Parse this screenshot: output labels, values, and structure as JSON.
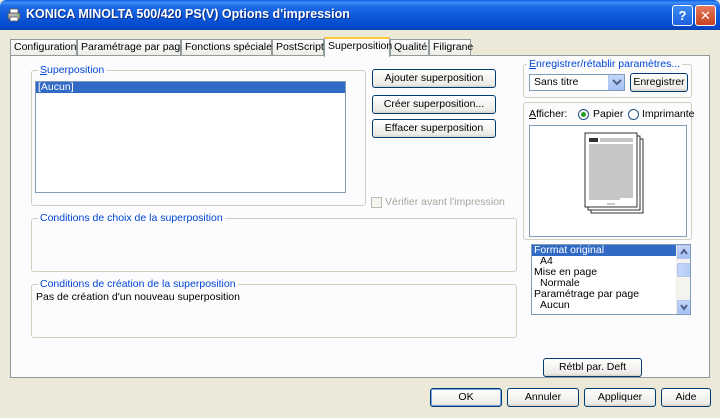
{
  "window": {
    "title": "KONICA MINOLTA 500/420 PS(V) Options d'impression",
    "help_label": "?",
    "close_label": "✕"
  },
  "tabs": [
    {
      "label": "Configuration"
    },
    {
      "label": "Paramétrage par page"
    },
    {
      "label": "Fonctions spéciales"
    },
    {
      "label": "PostScript"
    },
    {
      "label": "Superposition",
      "active": true
    },
    {
      "label": "Qualité"
    },
    {
      "label": "Filigrane"
    }
  ],
  "overlay": {
    "group_title": "Superposition",
    "list_items": [
      "[Aucun]"
    ],
    "add_button": "Ajouter superposition",
    "create_button": "Créer superposition...",
    "delete_button": "Effacer superposition",
    "verify_label": "Vérifier avant l'impression",
    "verify_checked": false
  },
  "choice_conditions": {
    "title": "Conditions de choix de la superposition",
    "text": ""
  },
  "creation_conditions": {
    "title": "Conditions de création de la superposition",
    "text": "Pas de création d'un nouveau superposition"
  },
  "save_restore": {
    "title": "Enregistrer/rétablir paramètres...",
    "combo_value": "Sans titre",
    "save_button": "Enregistrer"
  },
  "display": {
    "label": "Afficher:",
    "option_paper": "Papier",
    "option_printer": "Imprimante",
    "selected": "paper"
  },
  "summary_list": [
    {
      "text": "Format original",
      "selected": true,
      "indent": false
    },
    {
      "text": "A4",
      "selected": false,
      "indent": true
    },
    {
      "text": "Mise en page",
      "selected": false,
      "indent": false
    },
    {
      "text": "Normale",
      "selected": false,
      "indent": true
    },
    {
      "text": "Paramétrage par page",
      "selected": false,
      "indent": false
    },
    {
      "text": "Aucun",
      "selected": false,
      "indent": true
    }
  ],
  "default_button": "Rétbl par. Deft",
  "footer": {
    "ok": "OK",
    "cancel": "Annuler",
    "apply": "Appliquer",
    "help": "Aide"
  },
  "colors": {
    "title_bar": "#0a56d8",
    "selection": "#316ac5",
    "group_title": "#0046d5",
    "face": "#ece9d8"
  }
}
